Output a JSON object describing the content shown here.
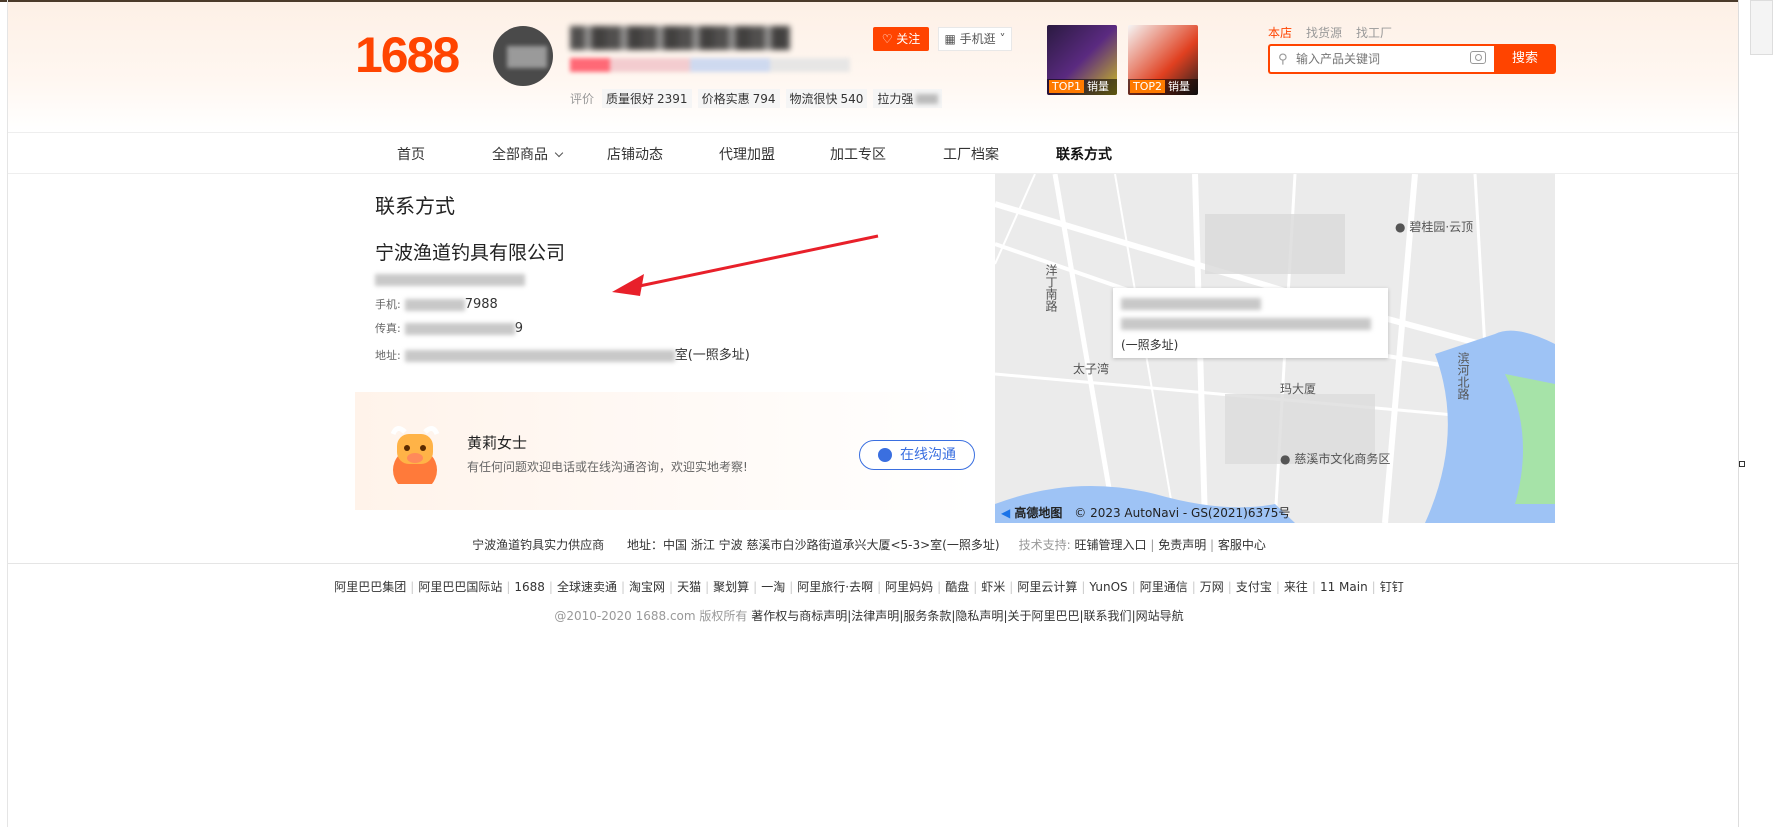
{
  "header": {
    "logo": "1688",
    "follow_label": "关注",
    "mobile_label": "手机逛",
    "rating_label": "评价",
    "ratings": [
      {
        "label": "质量很好",
        "value": "2391"
      },
      {
        "label": "价格实惠",
        "value": "794"
      },
      {
        "label": "物流很快",
        "value": "540"
      },
      {
        "label": "拉力强",
        "value": ""
      }
    ],
    "promos": [
      {
        "rank": "TOP1",
        "label": "销量"
      },
      {
        "rank": "TOP2",
        "label": "销量"
      }
    ],
    "search": {
      "tabs": [
        "本店",
        "找货源",
        "找工厂"
      ],
      "placeholder": "输入产品关键词",
      "button": "搜索"
    }
  },
  "nav": {
    "items": [
      "首页",
      "全部商品",
      "店铺动态",
      "代理加盟",
      "加工专区",
      "工厂档案",
      "联系方式"
    ]
  },
  "contact": {
    "title": "联系方式",
    "company": "宁波渔道钓具有限公司",
    "mobile_label": "手机:",
    "mobile_tail": "7988",
    "fax_label": "传真:",
    "fax_tail": "9",
    "address_label": "地址:",
    "address_tail": "室(一照多址)"
  },
  "agent": {
    "name": "黄莉女士",
    "desc": "有任何问题欢迎电话或在线沟通咨询，欢迎实地考察!",
    "chat_label": "在线沟通"
  },
  "map": {
    "labels": [
      "碧桂园·云顶",
      "洋丁南路",
      "太子湾",
      "慈溪市文化商务区",
      "滨河北路",
      "玛大厦"
    ],
    "popup_tail": "(一照多址)",
    "brand": "高德地图",
    "copyright": "© 2023 AutoNavi - GS(2021)6375号"
  },
  "footer": {
    "supplier": "宁波渔道钓具实力供应商",
    "address": "地址：中国 浙江 宁波 慈溪市白沙路街道承兴大厦<5-3>室(一照多址)",
    "tech_label": "技术支持:",
    "tech_links": [
      "旺铺管理入口",
      "免责声明",
      "客服中心"
    ],
    "links": [
      "阿里巴巴集团",
      "阿里巴巴国际站",
      "1688",
      "全球速卖通",
      "淘宝网",
      "天猫",
      "聚划算",
      "一淘",
      "阿里旅行·去啊",
      "阿里妈妈",
      "酷盘",
      "虾米",
      "阿里云计算",
      "YunOS",
      "阿里通信",
      "万网",
      "支付宝",
      "来往",
      "11 Main",
      "钉钉"
    ],
    "copyright": "@2010-2020 1688.com 版权所有",
    "legal_links": [
      "著作权与商标声明",
      "法律声明",
      "服务条款",
      "隐私声明",
      "关于阿里巴巴",
      "联系我们",
      "网站导航"
    ]
  },
  "colors": {
    "brand": "#ff4400",
    "chat_blue": "#3a6fe0"
  }
}
